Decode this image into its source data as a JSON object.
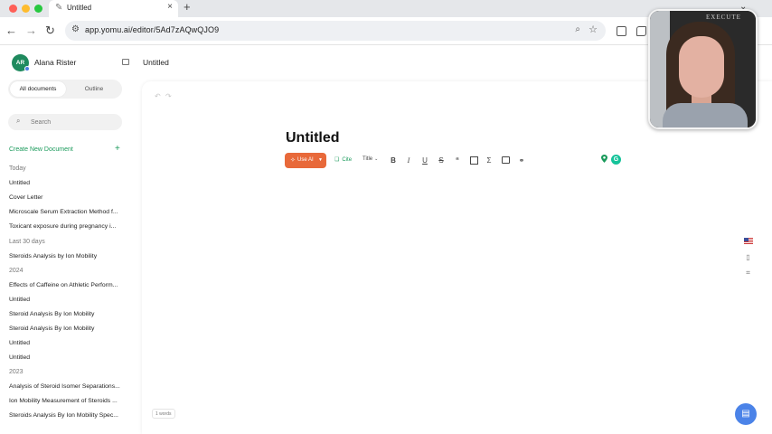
{
  "browser": {
    "tab_title": "Untitled",
    "new_tab_symbol": "+",
    "url": "app.yomu.ai/editor/5Ad7zAQwQJO9"
  },
  "sidebar": {
    "avatar_initials": "AR",
    "user_name": "Alana Rister",
    "segment": {
      "all": "All documents",
      "outline": "Outline"
    },
    "search_placeholder": "Search",
    "create_label": "Create New Document",
    "groups": [
      {
        "label": "Today",
        "docs": [
          "Untitled",
          "Cover Letter",
          "Microscale Serum Extraction Method f...",
          "Toxicant exposure during pregnancy i..."
        ]
      },
      {
        "label": "Last 30 days",
        "docs": [
          "Steroids Analysis by Ion Mobility"
        ]
      },
      {
        "label": "2024",
        "docs": [
          "Effects of Caffeine on Athletic Perform...",
          "Untitled",
          "Steroid Analysis By Ion Mobility",
          "Steroid Analysis By Ion Mobility",
          "Untitled",
          "Untitled"
        ]
      },
      {
        "label": "2023",
        "docs": [
          "Analysis of Steroid Isomer Separations...",
          "Ion Mobility Measurement of Steroids ...",
          "Steroids Analysis By Ion Mobility Spec..."
        ]
      }
    ]
  },
  "main": {
    "header_title": "Untitled",
    "doc_title": "Untitled",
    "toolbar": {
      "use_ai": "Use AI",
      "cite": "Cite",
      "block_type": "Title"
    },
    "word_count": "1 words"
  },
  "webcam": {
    "sign_text": "EXECUTE"
  },
  "colors": {
    "accent_green": "#1a9a5b",
    "use_ai_orange": "#e8693a",
    "help_blue": "#4b83e8",
    "grammarly_green": "#15c39a"
  }
}
